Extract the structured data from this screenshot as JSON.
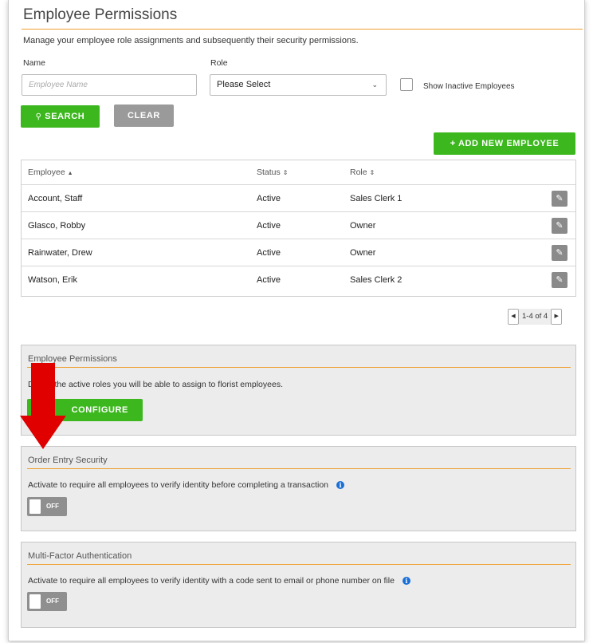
{
  "page": {
    "title": "Employee Permissions",
    "subtitle": "Manage your employee role assignments and subsequently their security permissions."
  },
  "filters": {
    "name_label": "Name",
    "name_placeholder": "Employee Name",
    "role_label": "Role",
    "role_value": "Please Select",
    "show_inactive_label": "Show Inactive Employees",
    "show_inactive_checked": false,
    "search_label": "SEARCH",
    "clear_label": "CLEAR"
  },
  "add_employee_label": "+ ADD NEW EMPLOYEE",
  "table": {
    "columns": [
      "Employee",
      "Status",
      "Role"
    ],
    "rows": [
      {
        "employee": "Account, Staff",
        "status": "Active",
        "role": "Sales Clerk 1"
      },
      {
        "employee": "Glasco, Robby",
        "status": "Active",
        "role": "Owner"
      },
      {
        "employee": "Rainwater, Drew",
        "status": "Active",
        "role": "Owner"
      },
      {
        "employee": "Watson, Erik",
        "status": "Active",
        "role": "Sales Clerk 2"
      }
    ]
  },
  "pagination": {
    "text": "1-4 of 4"
  },
  "permissions_panel": {
    "title": "Employee Permissions",
    "text": "the active roles you will be able to assign to florist employees.",
    "text_prefix": "D",
    "button_label": "CONFIGURE"
  },
  "order_entry_panel": {
    "title": "Order Entry Security",
    "text": "Activate to require all employees to verify identity before completing a transaction",
    "toggle": "OFF"
  },
  "mfa_panel": {
    "title": "Multi-Factor Authentication",
    "text": "Activate to require all employees to verify identity with a code sent to email or phone number on file",
    "toggle": "OFF"
  },
  "colors": {
    "accent_green": "#3cb81e",
    "rule_orange": "#f0a030",
    "annotation_red": "#e00000",
    "info_blue": "#1a6fd6"
  }
}
